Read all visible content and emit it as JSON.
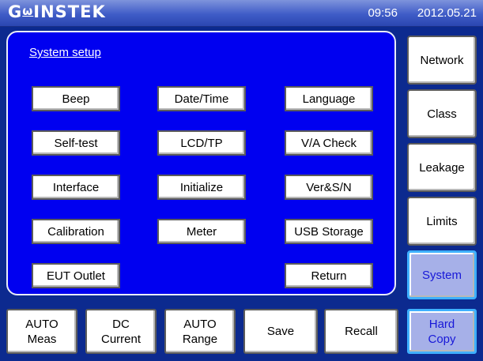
{
  "header": {
    "brand": "GᵂINSTEK",
    "time": "09:56",
    "date": "2012.05.21"
  },
  "panel": {
    "title": "System setup",
    "buttons": [
      {
        "label": "Beep"
      },
      {
        "label": "Date/Time"
      },
      {
        "label": "Language"
      },
      {
        "label": "Self-test"
      },
      {
        "label": "LCD/TP"
      },
      {
        "label": "V/A Check"
      },
      {
        "label": "Interface"
      },
      {
        "label": "Initialize"
      },
      {
        "label": "Ver&S/N"
      },
      {
        "label": "Calibration"
      },
      {
        "label": "Meter"
      },
      {
        "label": "USB Storage"
      },
      {
        "label": "EUT Outlet"
      },
      {
        "label": "Return"
      }
    ]
  },
  "sidebar": {
    "items": [
      {
        "label": "Network"
      },
      {
        "label": "Class"
      },
      {
        "label": "Leakage"
      },
      {
        "label": "Limits"
      },
      {
        "label": "System",
        "active": true
      }
    ]
  },
  "bottom": {
    "items": [
      {
        "line1": "AUTO",
        "line2": "Meas"
      },
      {
        "line1": "DC",
        "line2": "Current"
      },
      {
        "line1": "AUTO",
        "line2": "Range"
      },
      {
        "line1": "Save",
        "line2": ""
      },
      {
        "line1": "Recall",
        "line2": ""
      },
      {
        "line1": "Hard",
        "line2": "Copy",
        "active": true
      }
    ]
  },
  "colors": {
    "background": "#0c2a8f",
    "panel": "#0000f0",
    "active_button": "#a6b0e8",
    "active_text": "#1818d8",
    "active_border": "#3fb0ff"
  }
}
